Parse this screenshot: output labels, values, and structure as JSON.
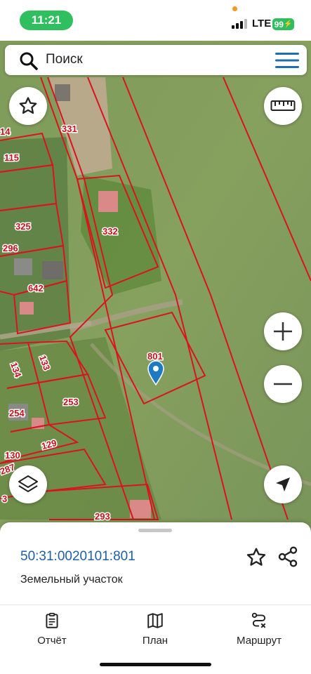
{
  "status_bar": {
    "time": "11:21",
    "network": "LTE",
    "battery": "99"
  },
  "search": {
    "placeholder": "Поиск"
  },
  "map": {
    "parcel_labels": [
      "331",
      "14",
      "115",
      "325",
      "296",
      "332",
      "642",
      "801",
      "134",
      "133",
      "254",
      "253",
      "129",
      "130",
      "287",
      "3",
      "293"
    ],
    "colors": {
      "boundary": "#d9141e",
      "label": "#c8101a",
      "marker": "#1f7ac4"
    }
  },
  "selected_parcel": {
    "cadastral_number": "50:31:0020101:801",
    "type": "Земельный участок"
  },
  "tabs": [
    {
      "label": "Отчёт",
      "icon": "report-icon"
    },
    {
      "label": "План",
      "icon": "map-plan-icon"
    },
    {
      "label": "Маршрут",
      "icon": "route-icon"
    }
  ],
  "colors": {
    "accent": "#1f5fa5",
    "status_green": "#2fbf5e"
  }
}
